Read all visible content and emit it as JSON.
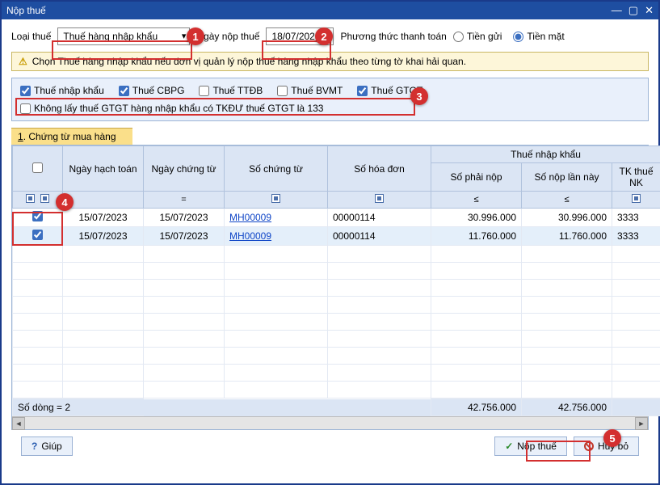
{
  "title_bar": {
    "title": "Nộp thuế"
  },
  "form": {
    "tax_type_label": "Loại thuế",
    "tax_type_value": "Thuế hàng nhập khẩu",
    "pay_date_label": "Ngày nộp thuế",
    "pay_date_value": "18/07/2023",
    "pay_method_label": "Phương thức thanh toán",
    "radio_transfer": "Tiền gửi",
    "radio_cash": "Tiền mặt"
  },
  "info": {
    "text": "Chọn Thuế hàng nhập khẩu nếu đơn vị quản lý nộp thuế hàng nhập khẩu theo từng tờ khai hải quan."
  },
  "checkboxes": {
    "nk": "Thuế nhập khẩu",
    "cbpg": "Thuế CBPG",
    "ttdb": "Thuế TTĐB",
    "bvmt": "Thuế BVMT",
    "gtgt": "Thuế GTGT",
    "exclude": "Không lấy thuế GTGT hàng nhập khẩu có TKĐƯ thuế GTGT là 133"
  },
  "section": {
    "num": "1",
    "title": "Chứng từ mua hàng"
  },
  "grid": {
    "headers": {
      "posting_date": "Ngày hạch toán",
      "doc_date": "Ngày chứng từ",
      "doc_no": "Số chứng từ",
      "invoice_no": "Số hóa đơn",
      "import_tax": "Thuế nhập khẩu",
      "due": "Số phải nộp",
      "this_pay": "Số nộp lần này",
      "account": "TK thuế NK"
    },
    "rows": [
      {
        "posting_date": "15/07/2023",
        "doc_date": "15/07/2023",
        "doc_no": "MH00009",
        "invoice_no": "00000114",
        "due": "30.996.000",
        "this_pay": "30.996.000",
        "account": "3333"
      },
      {
        "posting_date": "15/07/2023",
        "doc_date": "15/07/2023",
        "doc_no": "MH00009",
        "invoice_no": "00000114",
        "due": "11.760.000",
        "this_pay": "11.760.000",
        "account": "3333"
      }
    ],
    "footer": {
      "rows_label": "Số dòng = 2",
      "total_due": "42.756.000",
      "total_pay": "42.756.000"
    }
  },
  "buttons": {
    "help": "Giúp",
    "submit": "Nộp thuế",
    "cancel": "Hủy bỏ"
  },
  "chart_data": {
    "type": "table",
    "columns": [
      "Ngày hạch toán",
      "Ngày chứng từ",
      "Số chứng từ",
      "Số hóa đơn",
      "Số phải nộp",
      "Số nộp lần này",
      "TK thuế NK"
    ],
    "rows": [
      [
        "15/07/2023",
        "15/07/2023",
        "MH00009",
        "00000114",
        30996000,
        30996000,
        "3333"
      ],
      [
        "15/07/2023",
        "15/07/2023",
        "MH00009",
        "00000114",
        11760000,
        11760000,
        "3333"
      ]
    ],
    "totals": {
      "Số phải nộp": 42756000,
      "Số nộp lần này": 42756000
    }
  }
}
